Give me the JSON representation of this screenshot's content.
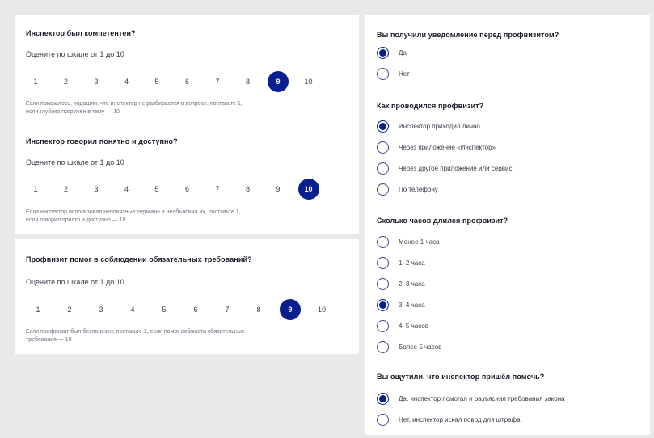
{
  "left_top": {
    "q1": {
      "title": "Инспектор был компетентен?",
      "subtitle": "Оцените по шкале от 1 до 10",
      "scale": [
        "1",
        "2",
        "3",
        "4",
        "5",
        "6",
        "7",
        "8",
        "9",
        "10"
      ],
      "selected": "9",
      "hint_line1": "Если показалось, подошли, что инспектор не разбирается в вопросе, поставьте 1,",
      "hint_line2": "если глубоко погружён в тему — 10"
    },
    "q2": {
      "title": "Инспектор говорил понятно и доступно?",
      "subtitle": "Оцените по шкале от 1 до 10",
      "scale": [
        "1",
        "2",
        "3",
        "4",
        "5",
        "6",
        "7",
        "8",
        "9",
        "10"
      ],
      "selected": "10",
      "hint_line1": "Если инспектор использовал непонятные термины и необъяснил их, поставьте 1,",
      "hint_line2": "если говорил просто и доступно — 10"
    }
  },
  "left_bottom": {
    "q3": {
      "title": "Профвизит помог в соблюдении обязательных требований?",
      "subtitle": "Оцените по шкале от 1 до 10",
      "scale": [
        "1",
        "2",
        "3",
        "4",
        "5",
        "6",
        "7",
        "8",
        "9",
        "10"
      ],
      "selected": "9",
      "hint_line1": "Если профвизит был бесполезен, поставьте 1, если помог соблюсти обязательные",
      "hint_line2": "требования — 10"
    }
  },
  "right": {
    "q4": {
      "title": "Вы получили уведомление перед профвизитом?",
      "options": [
        "Да",
        "Нет"
      ],
      "selected_index": 0
    },
    "q5": {
      "title": "Как проводился профвизит?",
      "options": [
        "Инспектор приходил лично",
        "Через приложение «Инспектор»",
        "Через другое приложение или сервис",
        "По телефону"
      ],
      "selected_index": 0
    },
    "q6": {
      "title": "Сколько часов длился профвизит?",
      "options": [
        "Менее 1 часа",
        "1–2 часа",
        "2–3 часа",
        "3–4 часа",
        "4–5 часов",
        "Более 5 часов"
      ],
      "selected_index": 3
    },
    "q7": {
      "title": "Вы ощутили, что инспектор пришёл помочь?",
      "options": [
        "Да, инспектор помогал и разъяснял требования закона",
        "Нет, инспектор искал повод для штрафа"
      ],
      "selected_index": 0
    }
  },
  "colors": {
    "accent": "#0a1f8f",
    "background": "#e7e9ea",
    "card": "#ffffff"
  }
}
